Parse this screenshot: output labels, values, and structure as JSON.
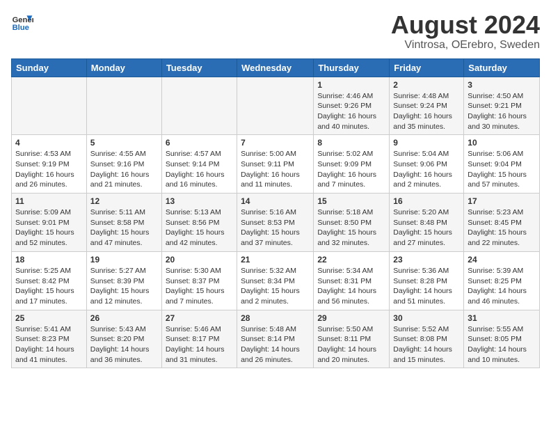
{
  "header": {
    "logo_line1": "General",
    "logo_line2": "Blue",
    "month_year": "August 2024",
    "location": "Vintrosa, OErebro, Sweden"
  },
  "days_of_week": [
    "Sunday",
    "Monday",
    "Tuesday",
    "Wednesday",
    "Thursday",
    "Friday",
    "Saturday"
  ],
  "weeks": [
    [
      {
        "day": "",
        "info": ""
      },
      {
        "day": "",
        "info": ""
      },
      {
        "day": "",
        "info": ""
      },
      {
        "day": "",
        "info": ""
      },
      {
        "day": "1",
        "info": "Sunrise: 4:46 AM\nSunset: 9:26 PM\nDaylight: 16 hours\nand 40 minutes."
      },
      {
        "day": "2",
        "info": "Sunrise: 4:48 AM\nSunset: 9:24 PM\nDaylight: 16 hours\nand 35 minutes."
      },
      {
        "day": "3",
        "info": "Sunrise: 4:50 AM\nSunset: 9:21 PM\nDaylight: 16 hours\nand 30 minutes."
      }
    ],
    [
      {
        "day": "4",
        "info": "Sunrise: 4:53 AM\nSunset: 9:19 PM\nDaylight: 16 hours\nand 26 minutes."
      },
      {
        "day": "5",
        "info": "Sunrise: 4:55 AM\nSunset: 9:16 PM\nDaylight: 16 hours\nand 21 minutes."
      },
      {
        "day": "6",
        "info": "Sunrise: 4:57 AM\nSunset: 9:14 PM\nDaylight: 16 hours\nand 16 minutes."
      },
      {
        "day": "7",
        "info": "Sunrise: 5:00 AM\nSunset: 9:11 PM\nDaylight: 16 hours\nand 11 minutes."
      },
      {
        "day": "8",
        "info": "Sunrise: 5:02 AM\nSunset: 9:09 PM\nDaylight: 16 hours\nand 7 minutes."
      },
      {
        "day": "9",
        "info": "Sunrise: 5:04 AM\nSunset: 9:06 PM\nDaylight: 16 hours\nand 2 minutes."
      },
      {
        "day": "10",
        "info": "Sunrise: 5:06 AM\nSunset: 9:04 PM\nDaylight: 15 hours\nand 57 minutes."
      }
    ],
    [
      {
        "day": "11",
        "info": "Sunrise: 5:09 AM\nSunset: 9:01 PM\nDaylight: 15 hours\nand 52 minutes."
      },
      {
        "day": "12",
        "info": "Sunrise: 5:11 AM\nSunset: 8:58 PM\nDaylight: 15 hours\nand 47 minutes."
      },
      {
        "day": "13",
        "info": "Sunrise: 5:13 AM\nSunset: 8:56 PM\nDaylight: 15 hours\nand 42 minutes."
      },
      {
        "day": "14",
        "info": "Sunrise: 5:16 AM\nSunset: 8:53 PM\nDaylight: 15 hours\nand 37 minutes."
      },
      {
        "day": "15",
        "info": "Sunrise: 5:18 AM\nSunset: 8:50 PM\nDaylight: 15 hours\nand 32 minutes."
      },
      {
        "day": "16",
        "info": "Sunrise: 5:20 AM\nSunset: 8:48 PM\nDaylight: 15 hours\nand 27 minutes."
      },
      {
        "day": "17",
        "info": "Sunrise: 5:23 AM\nSunset: 8:45 PM\nDaylight: 15 hours\nand 22 minutes."
      }
    ],
    [
      {
        "day": "18",
        "info": "Sunrise: 5:25 AM\nSunset: 8:42 PM\nDaylight: 15 hours\nand 17 minutes."
      },
      {
        "day": "19",
        "info": "Sunrise: 5:27 AM\nSunset: 8:39 PM\nDaylight: 15 hours\nand 12 minutes."
      },
      {
        "day": "20",
        "info": "Sunrise: 5:30 AM\nSunset: 8:37 PM\nDaylight: 15 hours\nand 7 minutes."
      },
      {
        "day": "21",
        "info": "Sunrise: 5:32 AM\nSunset: 8:34 PM\nDaylight: 15 hours\nand 2 minutes."
      },
      {
        "day": "22",
        "info": "Sunrise: 5:34 AM\nSunset: 8:31 PM\nDaylight: 14 hours\nand 56 minutes."
      },
      {
        "day": "23",
        "info": "Sunrise: 5:36 AM\nSunset: 8:28 PM\nDaylight: 14 hours\nand 51 minutes."
      },
      {
        "day": "24",
        "info": "Sunrise: 5:39 AM\nSunset: 8:25 PM\nDaylight: 14 hours\nand 46 minutes."
      }
    ],
    [
      {
        "day": "25",
        "info": "Sunrise: 5:41 AM\nSunset: 8:23 PM\nDaylight: 14 hours\nand 41 minutes."
      },
      {
        "day": "26",
        "info": "Sunrise: 5:43 AM\nSunset: 8:20 PM\nDaylight: 14 hours\nand 36 minutes."
      },
      {
        "day": "27",
        "info": "Sunrise: 5:46 AM\nSunset: 8:17 PM\nDaylight: 14 hours\nand 31 minutes."
      },
      {
        "day": "28",
        "info": "Sunrise: 5:48 AM\nSunset: 8:14 PM\nDaylight: 14 hours\nand 26 minutes."
      },
      {
        "day": "29",
        "info": "Sunrise: 5:50 AM\nSunset: 8:11 PM\nDaylight: 14 hours\nand 20 minutes."
      },
      {
        "day": "30",
        "info": "Sunrise: 5:52 AM\nSunset: 8:08 PM\nDaylight: 14 hours\nand 15 minutes."
      },
      {
        "day": "31",
        "info": "Sunrise: 5:55 AM\nSunset: 8:05 PM\nDaylight: 14 hours\nand 10 minutes."
      }
    ]
  ]
}
